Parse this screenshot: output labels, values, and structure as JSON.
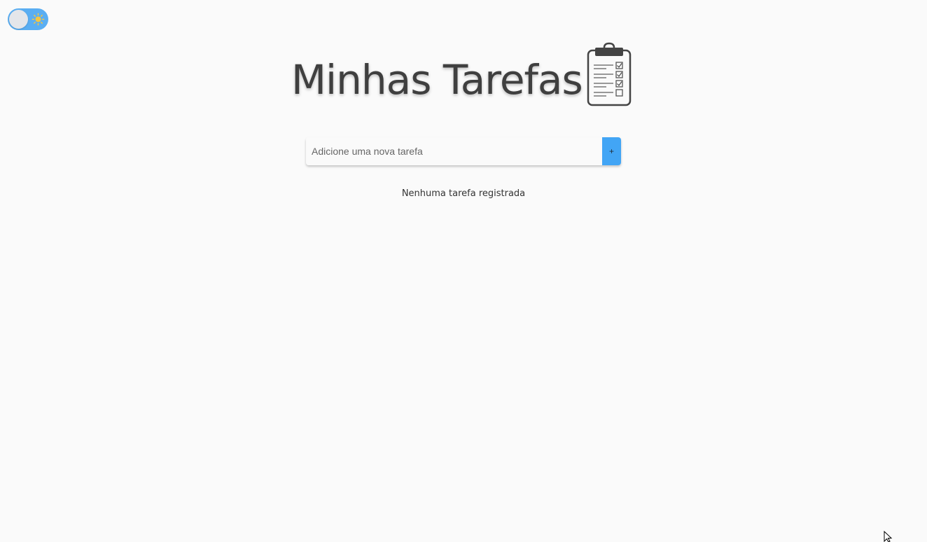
{
  "theme_toggle": {
    "icon": "sun-icon",
    "state": "light",
    "track_color": "#5aaef2",
    "sun_color": "#f4c542"
  },
  "header": {
    "title": "Minhas Tarefas",
    "icon": "clipboard-checklist-icon"
  },
  "task_form": {
    "input_value": "",
    "input_placeholder": "Adicione uma nova tarefa",
    "add_button_label": "+",
    "accent_color": "#42a5f5"
  },
  "task_list": {
    "empty_message": "Nenhuma tarefa registrada",
    "items": []
  }
}
